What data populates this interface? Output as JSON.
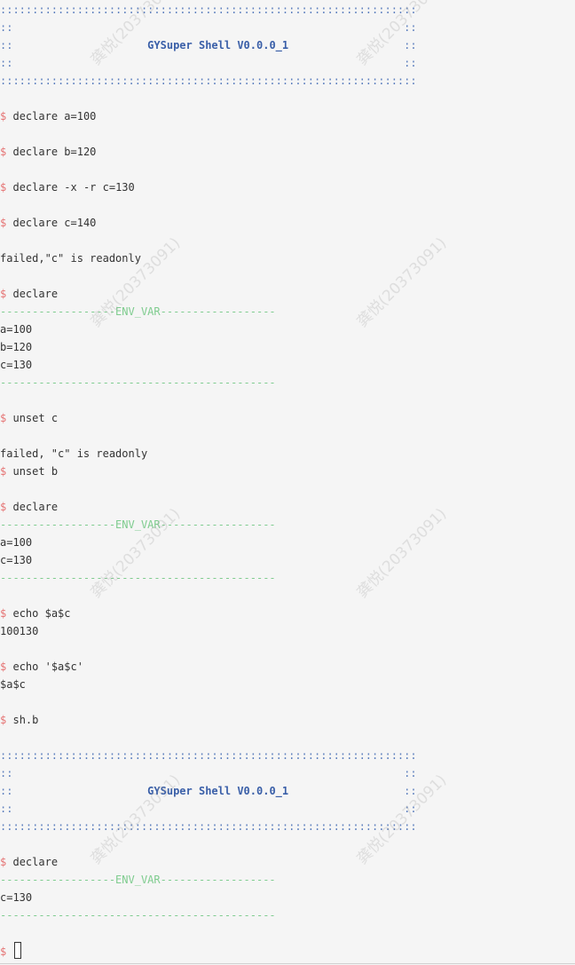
{
  "prompt_symbol": "$",
  "watermark_text": "龚悦(20373091)",
  "lines": [
    {
      "type": "banner-dots",
      "text": ":::::::::::::::::::::::::::::::::::::::::::::::::::::::::::::::::"
    },
    {
      "type": "banner-edge",
      "left": "::",
      "right": "::"
    },
    {
      "type": "banner-title",
      "left": "::",
      "title": "GYSuper Shell V0.0.0_1",
      "right": "::"
    },
    {
      "type": "banner-edge",
      "left": "::",
      "right": "::"
    },
    {
      "type": "banner-dots",
      "text": ":::::::::::::::::::::::::::::::::::::::::::::::::::::::::::::::::"
    },
    {
      "type": "blank"
    },
    {
      "type": "cmd",
      "text": "declare a=100"
    },
    {
      "type": "blank"
    },
    {
      "type": "cmd",
      "text": "declare b=120"
    },
    {
      "type": "blank"
    },
    {
      "type": "cmd",
      "text": "declare -x -r c=130"
    },
    {
      "type": "blank"
    },
    {
      "type": "cmd",
      "text": "declare c=140"
    },
    {
      "type": "blank"
    },
    {
      "type": "out",
      "text": "failed,\"c\" is readonly"
    },
    {
      "type": "blank"
    },
    {
      "type": "cmd",
      "text": "declare"
    },
    {
      "type": "env-rule",
      "text": "------------------ENV_VAR------------------"
    },
    {
      "type": "out",
      "text": "a=100"
    },
    {
      "type": "out",
      "text": "b=120"
    },
    {
      "type": "out",
      "text": "c=130"
    },
    {
      "type": "env-rule",
      "text": "-------------------------------------------"
    },
    {
      "type": "blank"
    },
    {
      "type": "cmd",
      "text": "unset c"
    },
    {
      "type": "blank"
    },
    {
      "type": "out",
      "text": "failed, \"c\" is readonly"
    },
    {
      "type": "cmd",
      "text": "unset b"
    },
    {
      "type": "blank"
    },
    {
      "type": "cmd",
      "text": "declare"
    },
    {
      "type": "env-rule",
      "text": "------------------ENV_VAR------------------"
    },
    {
      "type": "out",
      "text": "a=100"
    },
    {
      "type": "out",
      "text": "c=130"
    },
    {
      "type": "env-rule",
      "text": "-------------------------------------------"
    },
    {
      "type": "blank"
    },
    {
      "type": "cmd",
      "text": "echo $a$c"
    },
    {
      "type": "out",
      "text": "100130"
    },
    {
      "type": "blank"
    },
    {
      "type": "cmd",
      "text": "echo '$a$c'"
    },
    {
      "type": "out",
      "text": "$a$c"
    },
    {
      "type": "blank"
    },
    {
      "type": "cmd",
      "text": "sh.b"
    },
    {
      "type": "blank"
    },
    {
      "type": "banner-dots",
      "text": ":::::::::::::::::::::::::::::::::::::::::::::::::::::::::::::::::"
    },
    {
      "type": "banner-edge",
      "left": "::",
      "right": "::"
    },
    {
      "type": "banner-title",
      "left": "::",
      "title": "GYSuper Shell V0.0.0_1",
      "right": "::"
    },
    {
      "type": "banner-edge",
      "left": "::",
      "right": "::"
    },
    {
      "type": "banner-dots",
      "text": ":::::::::::::::::::::::::::::::::::::::::::::::::::::::::::::::::"
    },
    {
      "type": "blank"
    },
    {
      "type": "cmd",
      "text": "declare"
    },
    {
      "type": "env-rule",
      "text": "------------------ENV_VAR------------------"
    },
    {
      "type": "out",
      "text": "c=130"
    },
    {
      "type": "env-rule",
      "text": "-------------------------------------------"
    },
    {
      "type": "blank"
    },
    {
      "type": "input-prompt",
      "text": ""
    }
  ],
  "colors": {
    "prompt": "#e57373",
    "banner": "#5a7dbd",
    "title": "#3a5fa8",
    "env_rule": "#7fcc8f",
    "text": "#333333",
    "background": "#f5f5f5"
  }
}
